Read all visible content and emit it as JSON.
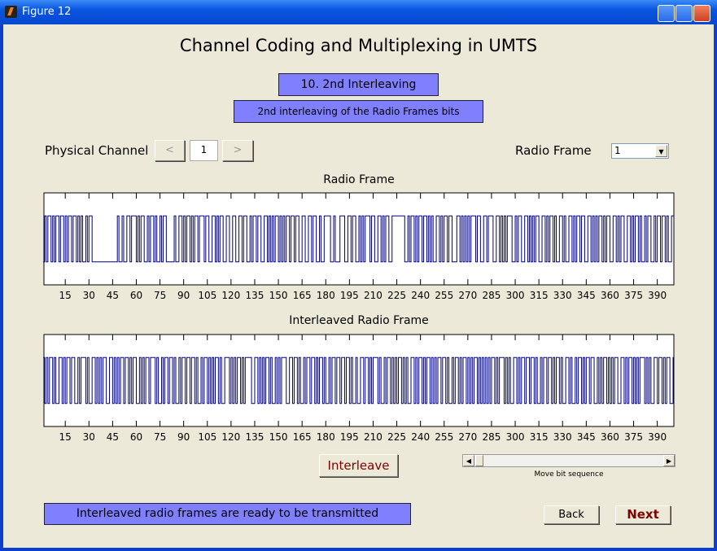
{
  "window": {
    "title": "Figure 12",
    "icon": "matlab-icon"
  },
  "header": {
    "title": "Channel Coding and Multiplexing in UMTS",
    "step": "10. 2nd Interleaving",
    "description": "2nd interleaving of the Radio Frames bits"
  },
  "controls": {
    "physical_channel_label": "Physical Channel",
    "prev_label": "<",
    "channel_value": "1",
    "next_small_label": ">",
    "radio_frame_label": "Radio Frame",
    "radio_frame_value": "1",
    "interleave_label": "Interleave",
    "slider_label": "Move bit sequence",
    "slider_value": 0,
    "status": "Interleaved radio frames are ready to be transmitted",
    "back_label": "Back",
    "next_label": "Next"
  },
  "colors": {
    "panel": "#8080FF",
    "signal": "#000080",
    "accent_text": "#800000",
    "background": "#ECE9D8"
  },
  "chart_data": [
    {
      "type": "line",
      "style": "stairs",
      "title": "Radio Frame",
      "xlim": [
        1.5,
        400.5
      ],
      "ylim": [
        -0.5,
        1.5
      ],
      "xticks": [
        15,
        30,
        45,
        60,
        75,
        90,
        105,
        120,
        135,
        150,
        165,
        180,
        195,
        210,
        225,
        240,
        255,
        270,
        285,
        300,
        315,
        330,
        345,
        360,
        375,
        390
      ],
      "bits": "0101101011011010110110101001011000000000000000010010011011101011001011010010110000010011010110101101110110011010110011001100110110010110110011010101101010110110110011001101100100111100100011100110110010101110110011010110011111111001011010110110101001101011011000110101010111011001101110011010101110010110011010101100110101101001101001101011011001101010110101100110101100110101101001011001011011010011"
    },
    {
      "type": "line",
      "style": "stairs",
      "title": "Interleaved Radio Frame",
      "xlim": [
        1.5,
        400.5
      ],
      "ylim": [
        -0.5,
        1.5
      ],
      "xticks": [
        15,
        30,
        45,
        60,
        75,
        90,
        105,
        120,
        135,
        150,
        165,
        180,
        195,
        210,
        225,
        240,
        255,
        270,
        285,
        300,
        315,
        330,
        345,
        360,
        375,
        390
      ],
      "bits": "1010110100110101101100101110100110101011001101010110110101100101011011101001011011010010110110110100101101010110100111010101101011110011010101101001010111001101101001011011010110100101101101101101001001101101011101001011010101101010011010110101101010110110100101101011010101101010101011010111010100110101101101101001011011010110100110100101101011011001010110101011001101011010101110101001101101011001"
    }
  ]
}
